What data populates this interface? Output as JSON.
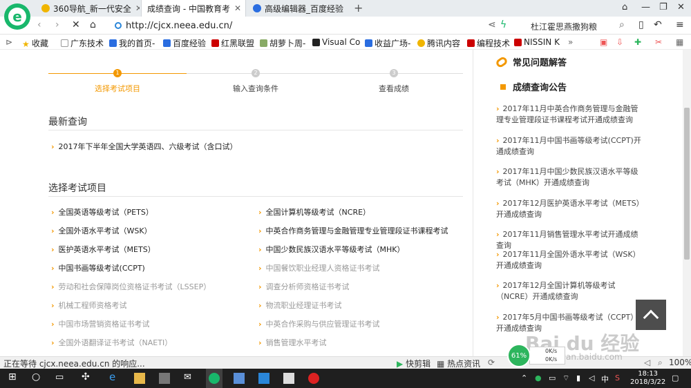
{
  "tabs": [
    {
      "label": "360导航_新一代安全",
      "color": "#f0b500"
    },
    {
      "label": "成绩查询 - 中国教育考",
      "color": "#ffffff"
    },
    {
      "label": "高级编辑器_百度经验",
      "color": "#2a6de0"
    }
  ],
  "address": {
    "url": "http://cjcx.neea.edu.cn/",
    "search": "杜江霍思燕撒狗粮"
  },
  "bookmarks": [
    "收藏",
    "广东技术",
    "我的首页-",
    "百度经验",
    "红黑联盟",
    "胡萝卜周-",
    "Visual Co",
    "收益广场-",
    "腾讯内容",
    "编程技术",
    "NISSIN K"
  ],
  "steps": [
    {
      "num": "1",
      "label": "选择考试项目"
    },
    {
      "num": "2",
      "label": "输入查询条件"
    },
    {
      "num": "3",
      "label": "查看成绩"
    }
  ],
  "recent": {
    "title": "最新查询",
    "items": [
      "2017年下半年全国大学英语四、六级考试（含口试）"
    ]
  },
  "exams": {
    "title": "选择考试项目",
    "left": [
      "全国英语等级考试（PETS）",
      "全国外语水平考试（WSK）",
      "医护英语水平考试（METS）",
      "中国书画等级考试(CCPT)",
      "劳动和社会保障岗位资格证书考试（LSSEP）",
      "机械工程师资格考试",
      "中国市场营销资格证书考试",
      "全国外语翻译证书考试（NAETI）"
    ],
    "right": [
      "全国计算机等级考试（NCRE）",
      "中英合作商务管理与金融管理专业管理段证书课程考试",
      "中国少数民族汉语水平等级考试（MHK）",
      "中国餐饮职业经理人资格证书考试",
      "调查分析师资格证书考试",
      "物流职业经理证书考试",
      "中英合作采购与供应管理证书考试",
      "销售管理水平考试"
    ]
  },
  "sidebar": {
    "faq_title": "常见问题解答",
    "notice_title": "成绩查询公告",
    "notices": [
      "2017年11月中英合作商务管理与金融管理专业管理段证书课程考试开通成绩查询",
      "2017年11月中国书画等级考试(CCPT)开通成绩查询",
      "2017年11月中国少数民族汉语水平等级考试（MHK）开通成绩查询",
      "2017年12月医护英语水平考试（METS）开通成绩查询",
      "2017年11月销售管理水平考试开通成绩查询",
      "2017年11月全国外语水平考试（WSK）开通成绩查询",
      "2017年12月全国计算机等级考试（NCRE）开通成绩查询",
      "2017年5月中国书画等级考试（CCPT）开通成绩查询"
    ]
  },
  "overlay": {
    "speed": "61%",
    "speed_up": "0K/s",
    "speed_down": "0K/s",
    "watermark": "Bai du 经验",
    "watermark_sub": "jingyan.baidu.com"
  },
  "status": {
    "loading": "正在等待 cjcx.neea.edu.cn 的响应...",
    "items": [
      "快剪辑",
      "热点资讯"
    ],
    "zoom": "100%"
  },
  "taskbar": {
    "time": "18:13",
    "date": "2018/3/22",
    "ime": "中"
  }
}
